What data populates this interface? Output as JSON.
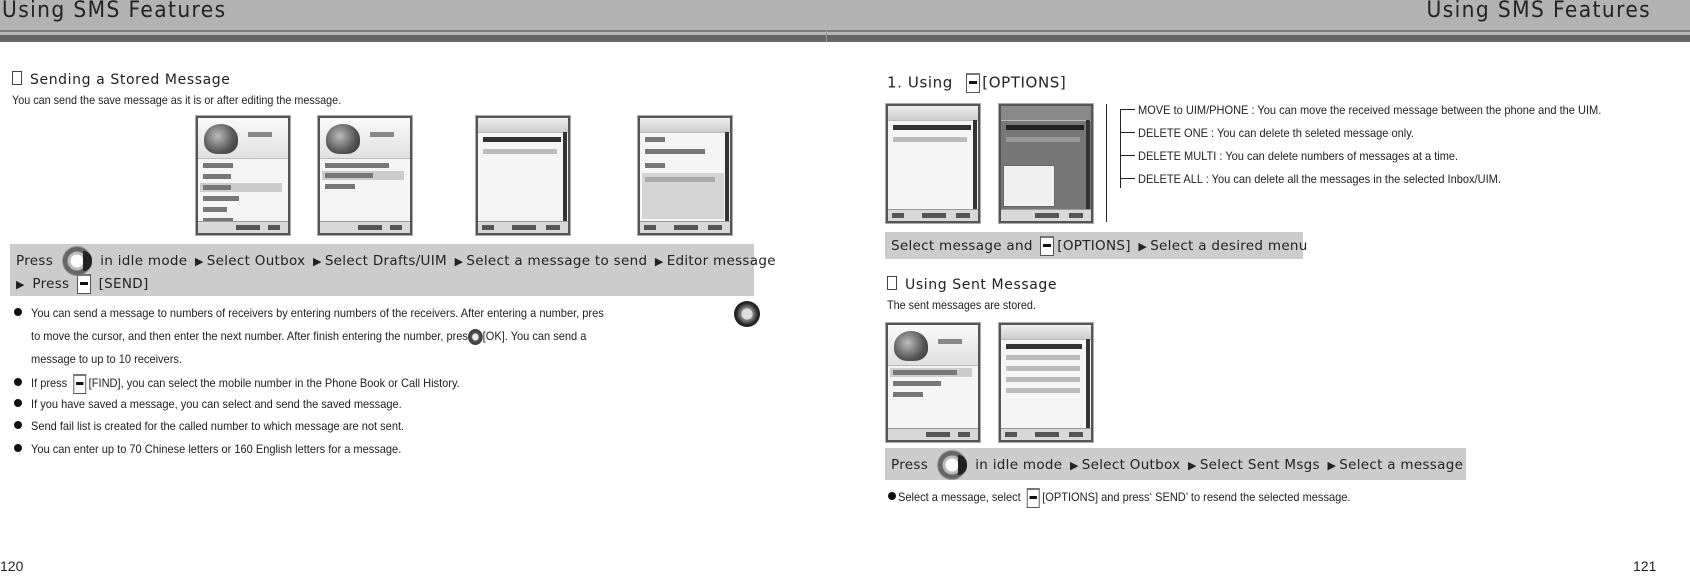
{
  "header": {
    "left_title": "Using SMS Features",
    "right_title": "Using SMS Features"
  },
  "left_page": {
    "section_title": "Sending a Stored Message",
    "intro": "You can send the save message as it is or after editing the message.",
    "instruction_bar": {
      "line1": {
        "press": "Press",
        "key_icon": "navigation-key-icon",
        "steps": [
          "in idle mode",
          "Select Outbox",
          "Select Drafts/UIM",
          "Select a message to send",
          "Editor message"
        ]
      },
      "line2": {
        "press": "Press",
        "key_icon": "soft-key-icon",
        "label": "[SEND]"
      }
    },
    "bullets": [
      {
        "part1": "You can send a message to numbers of receivers by entering numbers of the receivers. After entering a number, pres",
        "icon": "navigation-key-icon"
      },
      {
        "part1": "to move the cursor, and then enter the next number. After finish entering the number, pres",
        "icon": "ok-key-icon",
        "part2": "[OK]. You can send a"
      },
      {
        "part1": "message to up to 10 receivers."
      },
      {
        "part1": "If press",
        "icon": "soft-key-icon",
        "part2": "[FIND], you can select the mobile number in the Phone Book or Call History."
      },
      {
        "part1": "If you have saved a message, you can select and send the saved message."
      },
      {
        "part1": "Send fail list is created for the called number to which message are not sent."
      },
      {
        "part1": "You can enter up to 70 Chinese letters or 160 English letters for a message."
      }
    ],
    "page_number": "120"
  },
  "right_page": {
    "section1": {
      "title_prefix": "1. Using",
      "title_suffix": "[OPTIONS]",
      "menu_items": [
        "MOVE to UIM/PHONE : You can move the received message between the phone and the UIM.",
        "DELETE ONE : You can delete th seleted message only.",
        "DELETE MULTI : You can delete numbers of messages at a time.",
        "DELETE ALL : You can delete all the messages in the selected Inbox/UIM."
      ],
      "instruction_bar": {
        "prefix": "Select message and",
        "label": "[OPTIONS]",
        "step": "Select a desired menu"
      }
    },
    "section2": {
      "title": "Using Sent Message",
      "intro": "The sent messages are stored.",
      "instruction_bar": {
        "press": "Press",
        "steps": [
          "in idle mode",
          "Select Outbox",
          "Select Sent Msgs",
          "Select a message"
        ]
      },
      "note": {
        "part1": "Select a message, select",
        "part2": "[OPTIONS] and press‘ SEND’ to resend the selected message."
      }
    },
    "page_number": "121"
  }
}
